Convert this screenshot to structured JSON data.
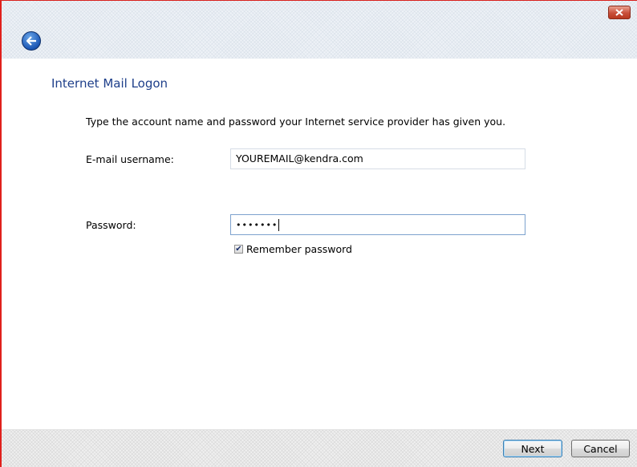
{
  "window": {
    "accent_border_color": "#e0201c",
    "close_icon": "close-icon",
    "back_icon": "back-arrow-icon"
  },
  "page": {
    "title": "Internet Mail Logon",
    "instructions": "Type the account name and password your Internet service provider has given you."
  },
  "form": {
    "username_label": "E-mail username:",
    "username_value": "YOUREMAIL@kendra.com",
    "password_label": "Password:",
    "password_mask": "•••••••",
    "remember_label": "Remember password",
    "remember_checked": true
  },
  "footer": {
    "next_label": "Next",
    "cancel_label": "Cancel"
  }
}
